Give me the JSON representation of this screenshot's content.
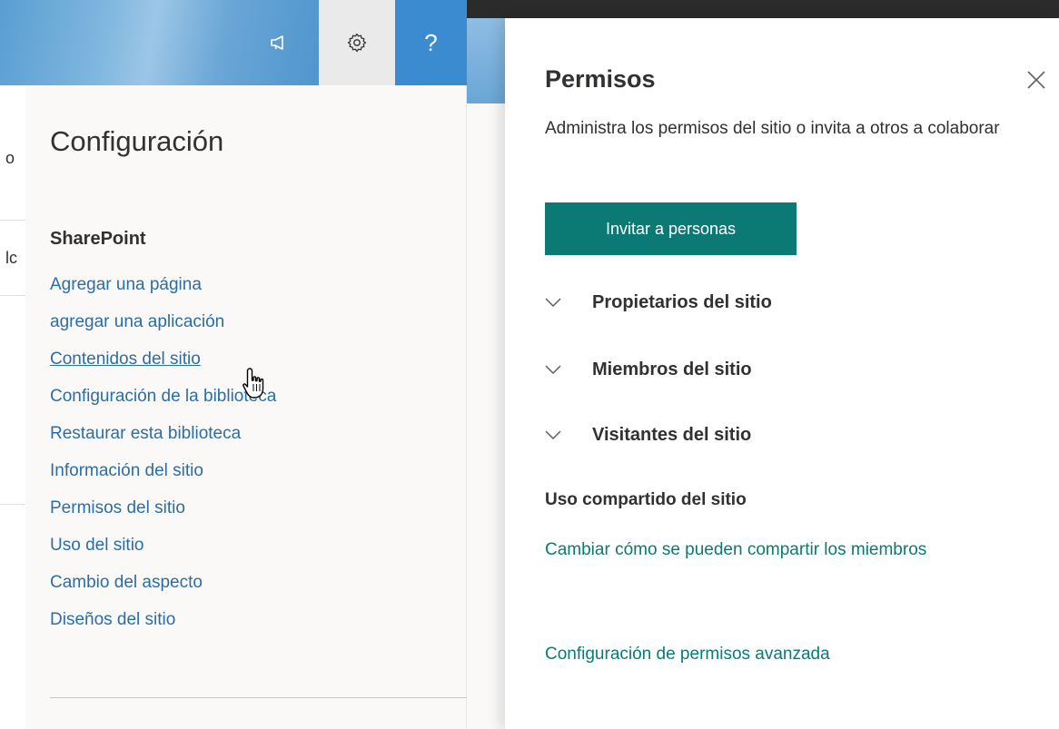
{
  "background_page": {
    "fragment_1": "o",
    "fragment_2": "lc"
  },
  "header": {
    "feedback_icon": "megaphone-icon",
    "settings_icon": "gear-icon",
    "help_icon": "help-icon",
    "help_label": "?"
  },
  "settings": {
    "title": "Configuración",
    "section": "SharePoint",
    "links": [
      "Agregar una página",
      "agregar una aplicación",
      "Contenidos del sitio",
      "Configuración de la biblioteca",
      "Restaurar esta biblioteca",
      "Información del sitio",
      "Permisos del sitio",
      "Uso del sitio",
      "Cambio del aspecto",
      "Diseños del sitio"
    ]
  },
  "permissions": {
    "title": "Permisos",
    "description": "Administra los permisos del sitio o invita a otros a colaborar",
    "invite_button": "Invitar a personas",
    "groups": [
      "Propietarios del sitio",
      "Miembros del sitio",
      "Visitantes del sitio"
    ],
    "sharing_heading": "Uso compartido del sitio",
    "sharing_link": "Cambiar cómo se pueden compartir los miembros",
    "advanced_link": "Configuración de permisos avanzada"
  },
  "colors": {
    "accent_teal": "#0b7a75",
    "link_blue": "#2b6ea5",
    "help_blue": "#3b8bd0"
  }
}
